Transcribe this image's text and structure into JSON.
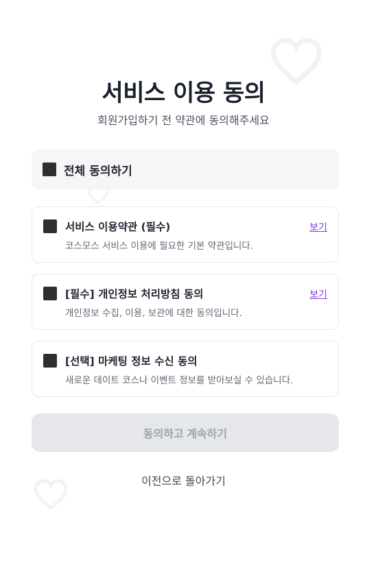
{
  "header": {
    "title": "서비스 이용 동의",
    "subtitle": "회원가입하기 전 약관에 동의해주세요"
  },
  "all_agree": {
    "label": "전체 동의하기",
    "checked": false
  },
  "terms": [
    {
      "title": "서비스 이용약관 (필수)",
      "description": "코스모스 서비스 이용에 필요한 기본 약관입니다.",
      "view_label": "보기",
      "checked": false
    },
    {
      "title": "[필수] 개인정보 처리방침 동의",
      "description": "개인정보 수집, 이용, 보관에 대한 동의입니다.",
      "view_label": "보기",
      "checked": false
    },
    {
      "title": "[선택] 마케팅 정보 수신 동의",
      "description": "새로운 데이트 코스나 이벤트 정보를 받아보실 수 있습니다.",
      "checked": false
    }
  ],
  "actions": {
    "continue_label": "동의하고 계속하기",
    "continue_enabled": false,
    "back_label": "이전으로 돌아가기"
  },
  "colors": {
    "accent_link": "#7c3aed",
    "checkbox": "#2f2f33",
    "disabled_button": "#e5e7eb",
    "disabled_text": "#9ca3af",
    "decor_heart": "#f3f4f6"
  },
  "icons": {
    "decor": "heart-icon",
    "checkbox": "checkbox-unchecked"
  }
}
